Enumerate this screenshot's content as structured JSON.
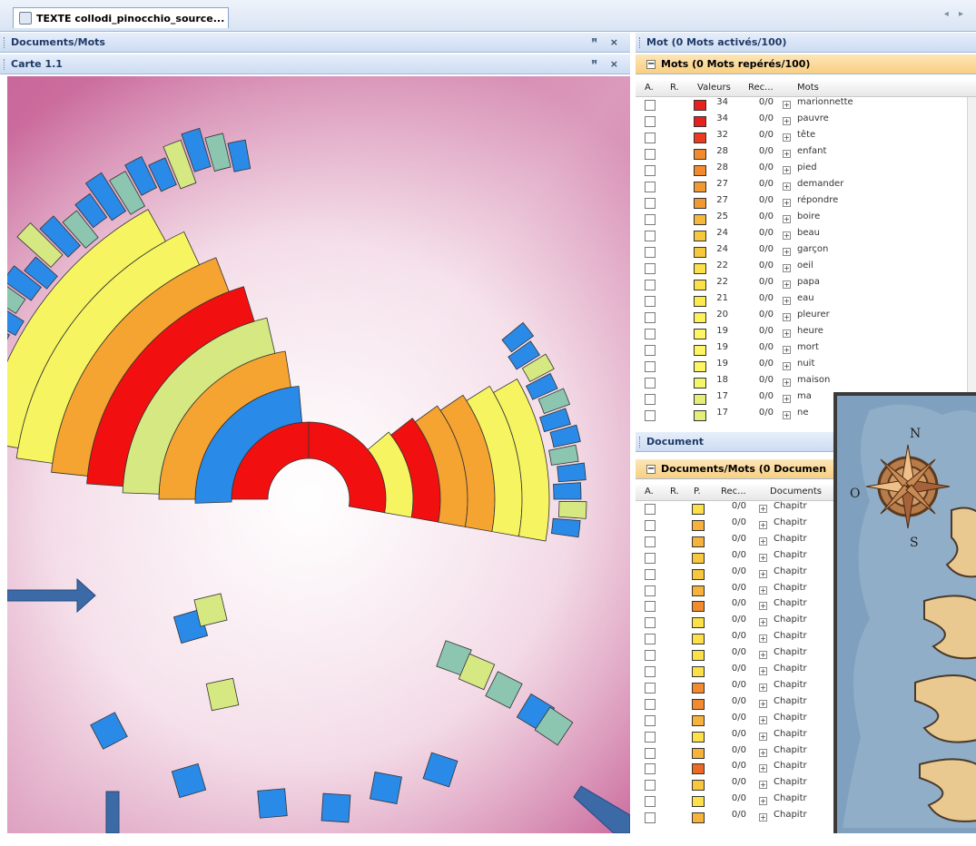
{
  "tab": {
    "title": "TEXTE collodi_pinocchio_source..."
  },
  "panes": {
    "documents_mots": "Documents/Mots",
    "carte": "Carte 1.1",
    "pin_close": "ꟸ ×",
    "mot": "Mot (0 Mots activés/100)",
    "mots_group": "Mots (0 Mots repérés/100)",
    "document": "Document",
    "docs_group": "Documents/Mots (0 Documen"
  },
  "mots_table": {
    "headers": [
      "A.",
      "R.",
      "Valeurs",
      "Rec...",
      "Mots"
    ],
    "rows": [
      {
        "value": "34",
        "rec": "0/0",
        "word": "marionnette",
        "color": "#e8201c"
      },
      {
        "value": "34",
        "rec": "0/0",
        "word": "pauvre",
        "color": "#e8201c"
      },
      {
        "value": "32",
        "rec": "0/0",
        "word": "tête",
        "color": "#ec3a1e"
      },
      {
        "value": "28",
        "rec": "0/0",
        "word": "enfant",
        "color": "#f28a2e"
      },
      {
        "value": "28",
        "rec": "0/0",
        "word": "pied",
        "color": "#f28a2e"
      },
      {
        "value": "27",
        "rec": "0/0",
        "word": "demander",
        "color": "#f29a32"
      },
      {
        "value": "27",
        "rec": "0/0",
        "word": "répondre",
        "color": "#f29a32"
      },
      {
        "value": "25",
        "rec": "0/0",
        "word": "boire",
        "color": "#f5b83a"
      },
      {
        "value": "24",
        "rec": "0/0",
        "word": "beau",
        "color": "#f7c83e"
      },
      {
        "value": "24",
        "rec": "0/0",
        "word": "garçon",
        "color": "#f7c83e"
      },
      {
        "value": "22",
        "rec": "0/0",
        "word": "oeil",
        "color": "#fbe04a"
      },
      {
        "value": "22",
        "rec": "0/0",
        "word": "papa",
        "color": "#fbe04a"
      },
      {
        "value": "21",
        "rec": "0/0",
        "word": "eau",
        "color": "#fce94e"
      },
      {
        "value": "20",
        "rec": "0/0",
        "word": "pleurer",
        "color": "#fdf25a"
      },
      {
        "value": "19",
        "rec": "0/0",
        "word": "heure",
        "color": "#fdf563"
      },
      {
        "value": "19",
        "rec": "0/0",
        "word": "mort",
        "color": "#fdf563"
      },
      {
        "value": "19",
        "rec": "0/0",
        "word": "nuit",
        "color": "#fdf563"
      },
      {
        "value": "18",
        "rec": "0/0",
        "word": "maison",
        "color": "#f3f56a"
      },
      {
        "value": "17",
        "rec": "0/0",
        "word": "ma",
        "color": "#e4ef78"
      },
      {
        "value": "17",
        "rec": "0/0",
        "word": "ne",
        "color": "#e4ef78"
      }
    ]
  },
  "docs_table": {
    "headers": [
      "A.",
      "R.",
      "P.",
      "Rec...",
      "Documents"
    ],
    "rows": [
      {
        "rec": "0/0",
        "name": "Chapitr",
        "color": "#fbe04a"
      },
      {
        "rec": "0/0",
        "name": "Chapitr",
        "color": "#f7b23c"
      },
      {
        "rec": "0/0",
        "name": "Chapitr",
        "color": "#f7b23c"
      },
      {
        "rec": "0/0",
        "name": "Chapitr",
        "color": "#f7c83e"
      },
      {
        "rec": "0/0",
        "name": "Chapitr",
        "color": "#f7c83e"
      },
      {
        "rec": "0/0",
        "name": "Chapitr",
        "color": "#f7b23c"
      },
      {
        "rec": "0/0",
        "name": "Chapitr",
        "color": "#f28a2e"
      },
      {
        "rec": "0/0",
        "name": "Chapitr",
        "color": "#fbe04a"
      },
      {
        "rec": "0/0",
        "name": "Chapitr",
        "color": "#fbe04a"
      },
      {
        "rec": "0/0",
        "name": "Chapitr",
        "color": "#fbe04a"
      },
      {
        "rec": "0/0",
        "name": "Chapitr",
        "color": "#fbe04a"
      },
      {
        "rec": "0/0",
        "name": "Chapitr",
        "color": "#f28a2e"
      },
      {
        "rec": "0/0",
        "name": "Chapitr",
        "color": "#f28a2e"
      },
      {
        "rec": "0/0",
        "name": "Chapitr",
        "color": "#f7b23c"
      },
      {
        "rec": "0/0",
        "name": "Chapitr",
        "color": "#fbe04a"
      },
      {
        "rec": "0/0",
        "name": "Chapitr",
        "color": "#f7b23c"
      },
      {
        "rec": "0/0",
        "name": "Chapitr",
        "color": "#ec6a26"
      },
      {
        "rec": "0/0",
        "name": "Chapitr",
        "color": "#f7c83e"
      },
      {
        "rec": "0/0",
        "name": "Chapitr",
        "color": "#fbe04a"
      },
      {
        "rec": "0/0",
        "name": "Chapitr",
        "color": "#f7b23c"
      }
    ]
  },
  "map": {
    "compass_letters": [
      "N",
      "S",
      "O"
    ],
    "colors": {
      "red": "#f20f0f",
      "blue": "#2a8ae8",
      "orange": "#f5a331",
      "yellow": "#f6f561",
      "lime": "#d6e882",
      "teal": "#8cc5b0"
    }
  }
}
